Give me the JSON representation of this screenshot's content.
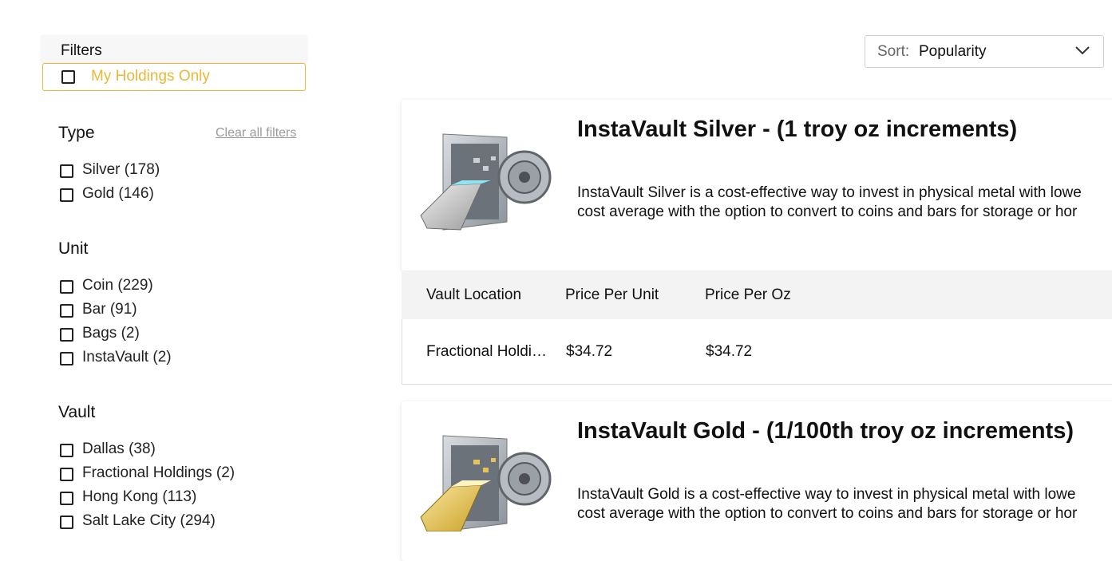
{
  "filters": {
    "title": "Filters",
    "my_holdings_label": "My Holdings Only",
    "clear_all": "Clear all filters",
    "accent_color": "#e8b83a",
    "sections": {
      "type": {
        "title": "Type",
        "items": [
          {
            "label": "Silver (178)"
          },
          {
            "label": "Gold (146)"
          }
        ]
      },
      "unit": {
        "title": "Unit",
        "items": [
          {
            "label": "Coin (229)"
          },
          {
            "label": "Bar (91)"
          },
          {
            "label": "Bags (2)"
          },
          {
            "label": "InstaVault (2)"
          }
        ]
      },
      "vault": {
        "title": "Vault",
        "items": [
          {
            "label": "Dallas (38)"
          },
          {
            "label": "Fractional Holdings (2)"
          },
          {
            "label": "Hong Kong (113)"
          },
          {
            "label": "Salt Lake City (294)"
          }
        ]
      }
    }
  },
  "sort": {
    "label": "Sort:",
    "value": "Popularity"
  },
  "products": [
    {
      "title": "InstaVault Silver - (1 troy oz increments)",
      "desc_line1": "InstaVault Silver is a cost-effective way to invest in physical metal with lowe",
      "desc_line2": "cost average with the option to convert to coins and bars for storage or hor",
      "image_icon": "vault-silver-bar-icon"
    },
    {
      "title": "InstaVault Gold - (1/100th troy oz increments)",
      "desc_line1": "InstaVault Gold is a cost-effective way to invest in physical metal with lowe",
      "desc_line2": "cost average with the option to convert to coins and bars for storage or hor",
      "image_icon": "vault-gold-bar-icon"
    }
  ],
  "table": {
    "headers": [
      "Vault Location",
      "Price Per Unit",
      "Price Per Oz"
    ],
    "rows": [
      [
        "Fractional Holdings",
        "$34.72",
        "$34.72"
      ]
    ]
  }
}
